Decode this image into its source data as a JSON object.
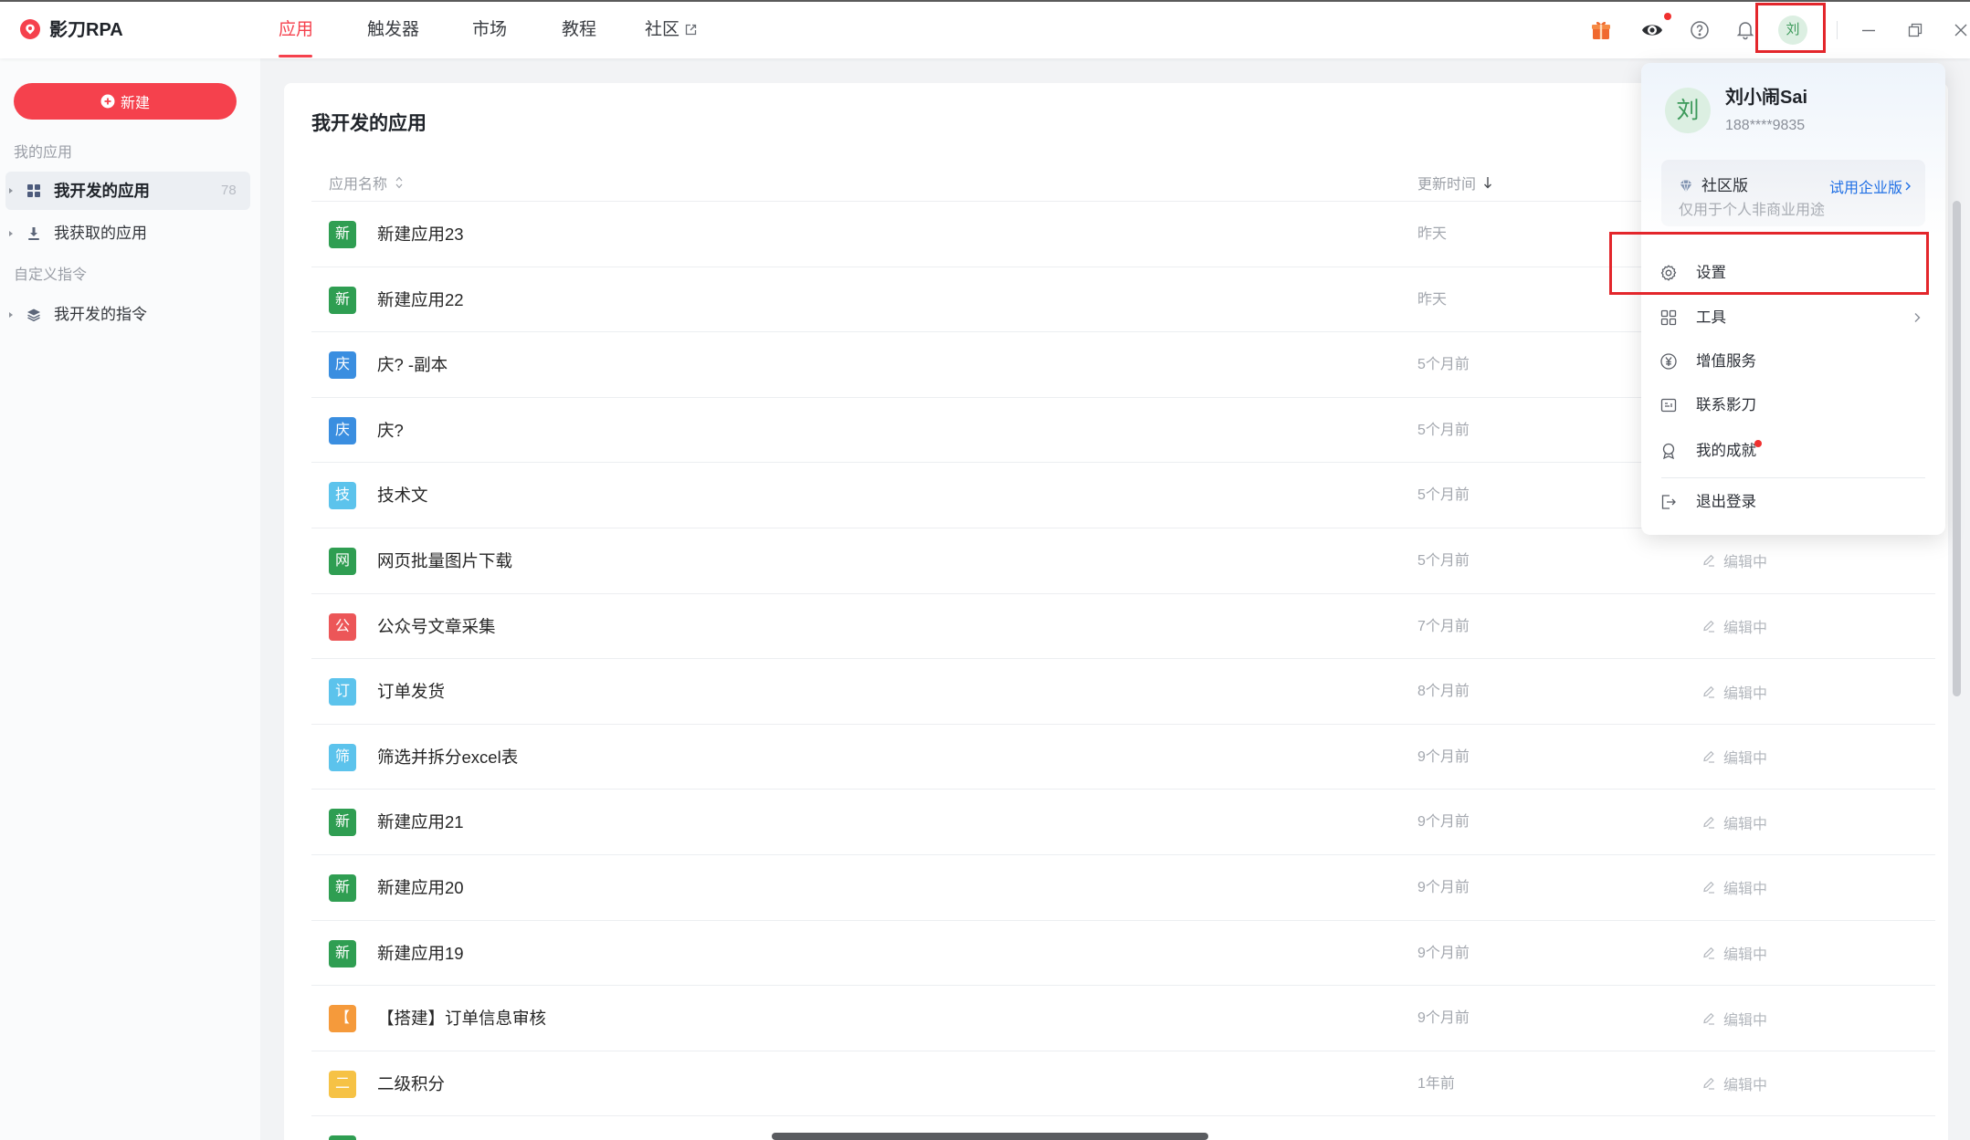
{
  "app": {
    "logo_text": "影刀RPA"
  },
  "nav": {
    "items": [
      {
        "label": "应用",
        "active": true
      },
      {
        "label": "触发器"
      },
      {
        "label": "市场"
      },
      {
        "label": "教程"
      },
      {
        "label": "社区",
        "icon": "external-link-icon"
      }
    ]
  },
  "header_icons": [
    "gift-icon",
    "robot-eye-icon",
    "help-icon",
    "bell-icon",
    "minimize-icon",
    "restore-icon",
    "close-icon"
  ],
  "user": {
    "avatar_char": "刘",
    "name": "刘小闹Sai",
    "phone": "188****9835"
  },
  "sidebar": {
    "new_button": "新建",
    "sections": [
      {
        "label": "我的应用",
        "items": [
          {
            "label": "我开发的应用",
            "count": "78",
            "selected": true,
            "icon": "grid-icon"
          },
          {
            "label": "我获取的应用",
            "icon": "download-icon"
          }
        ]
      },
      {
        "label": "自定义指令",
        "items": [
          {
            "label": "我开发的指令",
            "icon": "layers-icon"
          }
        ]
      }
    ]
  },
  "main": {
    "title": "我开发的应用",
    "columns": {
      "name": "应用名称",
      "updated": "更新时间"
    },
    "rows": [
      {
        "icon_char": "新",
        "icon_color": "#2f9e52",
        "name": "新建应用23",
        "updated": "昨天"
      },
      {
        "icon_char": "新",
        "icon_color": "#2f9e52",
        "name": "新建应用22",
        "updated": "昨天"
      },
      {
        "icon_char": "庆",
        "icon_color": "#3a8ee0",
        "name": "庆? -副本",
        "updated": "5个月前"
      },
      {
        "icon_char": "庆",
        "icon_color": "#3a8ee0",
        "name": "庆?",
        "updated": "5个月前"
      },
      {
        "icon_char": "技",
        "icon_color": "#5cc3ec",
        "name": "技术文",
        "updated": "5个月前"
      },
      {
        "icon_char": "网",
        "icon_color": "#2f9e52",
        "name": "网页批量图片下载",
        "updated": "5个月前",
        "status": "编辑中"
      },
      {
        "icon_char": "公",
        "icon_color": "#ec5658",
        "name": "公众号文章采集",
        "updated": "7个月前",
        "status": "编辑中"
      },
      {
        "icon_char": "订",
        "icon_color": "#5cc3ec",
        "name": "订单发货",
        "updated": "8个月前",
        "status": "编辑中"
      },
      {
        "icon_char": "筛",
        "icon_color": "#5cc3ec",
        "name": "筛选并拆分excel表",
        "updated": "9个月前",
        "status": "编辑中"
      },
      {
        "icon_char": "新",
        "icon_color": "#2f9e52",
        "name": "新建应用21",
        "updated": "9个月前",
        "status": "编辑中"
      },
      {
        "icon_char": "新",
        "icon_color": "#2f9e52",
        "name": "新建应用20",
        "updated": "9个月前",
        "status": "编辑中"
      },
      {
        "icon_char": "新",
        "icon_color": "#2f9e52",
        "name": "新建应用19",
        "updated": "9个月前",
        "status": "编辑中"
      },
      {
        "icon_char": "【",
        "icon_color": "#f59a3b",
        "name": "【搭建】订单信息审核",
        "updated": "9个月前",
        "status": "编辑中"
      },
      {
        "icon_char": "二",
        "icon_color": "#f6c245",
        "name": "二级积分",
        "updated": "1年前",
        "status": "编辑中"
      },
      {
        "icon_color": "#2f9e52"
      }
    ]
  },
  "dropdown": {
    "edition": {
      "name": "社区版",
      "trial_link": "试用企业版",
      "note": "仅用于个人非商业用途"
    },
    "menu": [
      {
        "label": "设置",
        "icon": "gear-icon"
      },
      {
        "label": "工具",
        "icon": "tools-icon",
        "has_submenu": true
      },
      {
        "label": "增值服务",
        "icon": "yen-icon"
      },
      {
        "label": "联系影刀",
        "icon": "contact-icon"
      },
      {
        "label": "我的成就",
        "icon": "award-icon",
        "badge_dot": true
      },
      {
        "label": "退出登录",
        "icon": "logout-icon"
      }
    ]
  },
  "colors": {
    "accent": "#f5414d",
    "link": "#1f6fe5",
    "annotation": "#e3262b",
    "notification": "#f0302f"
  }
}
